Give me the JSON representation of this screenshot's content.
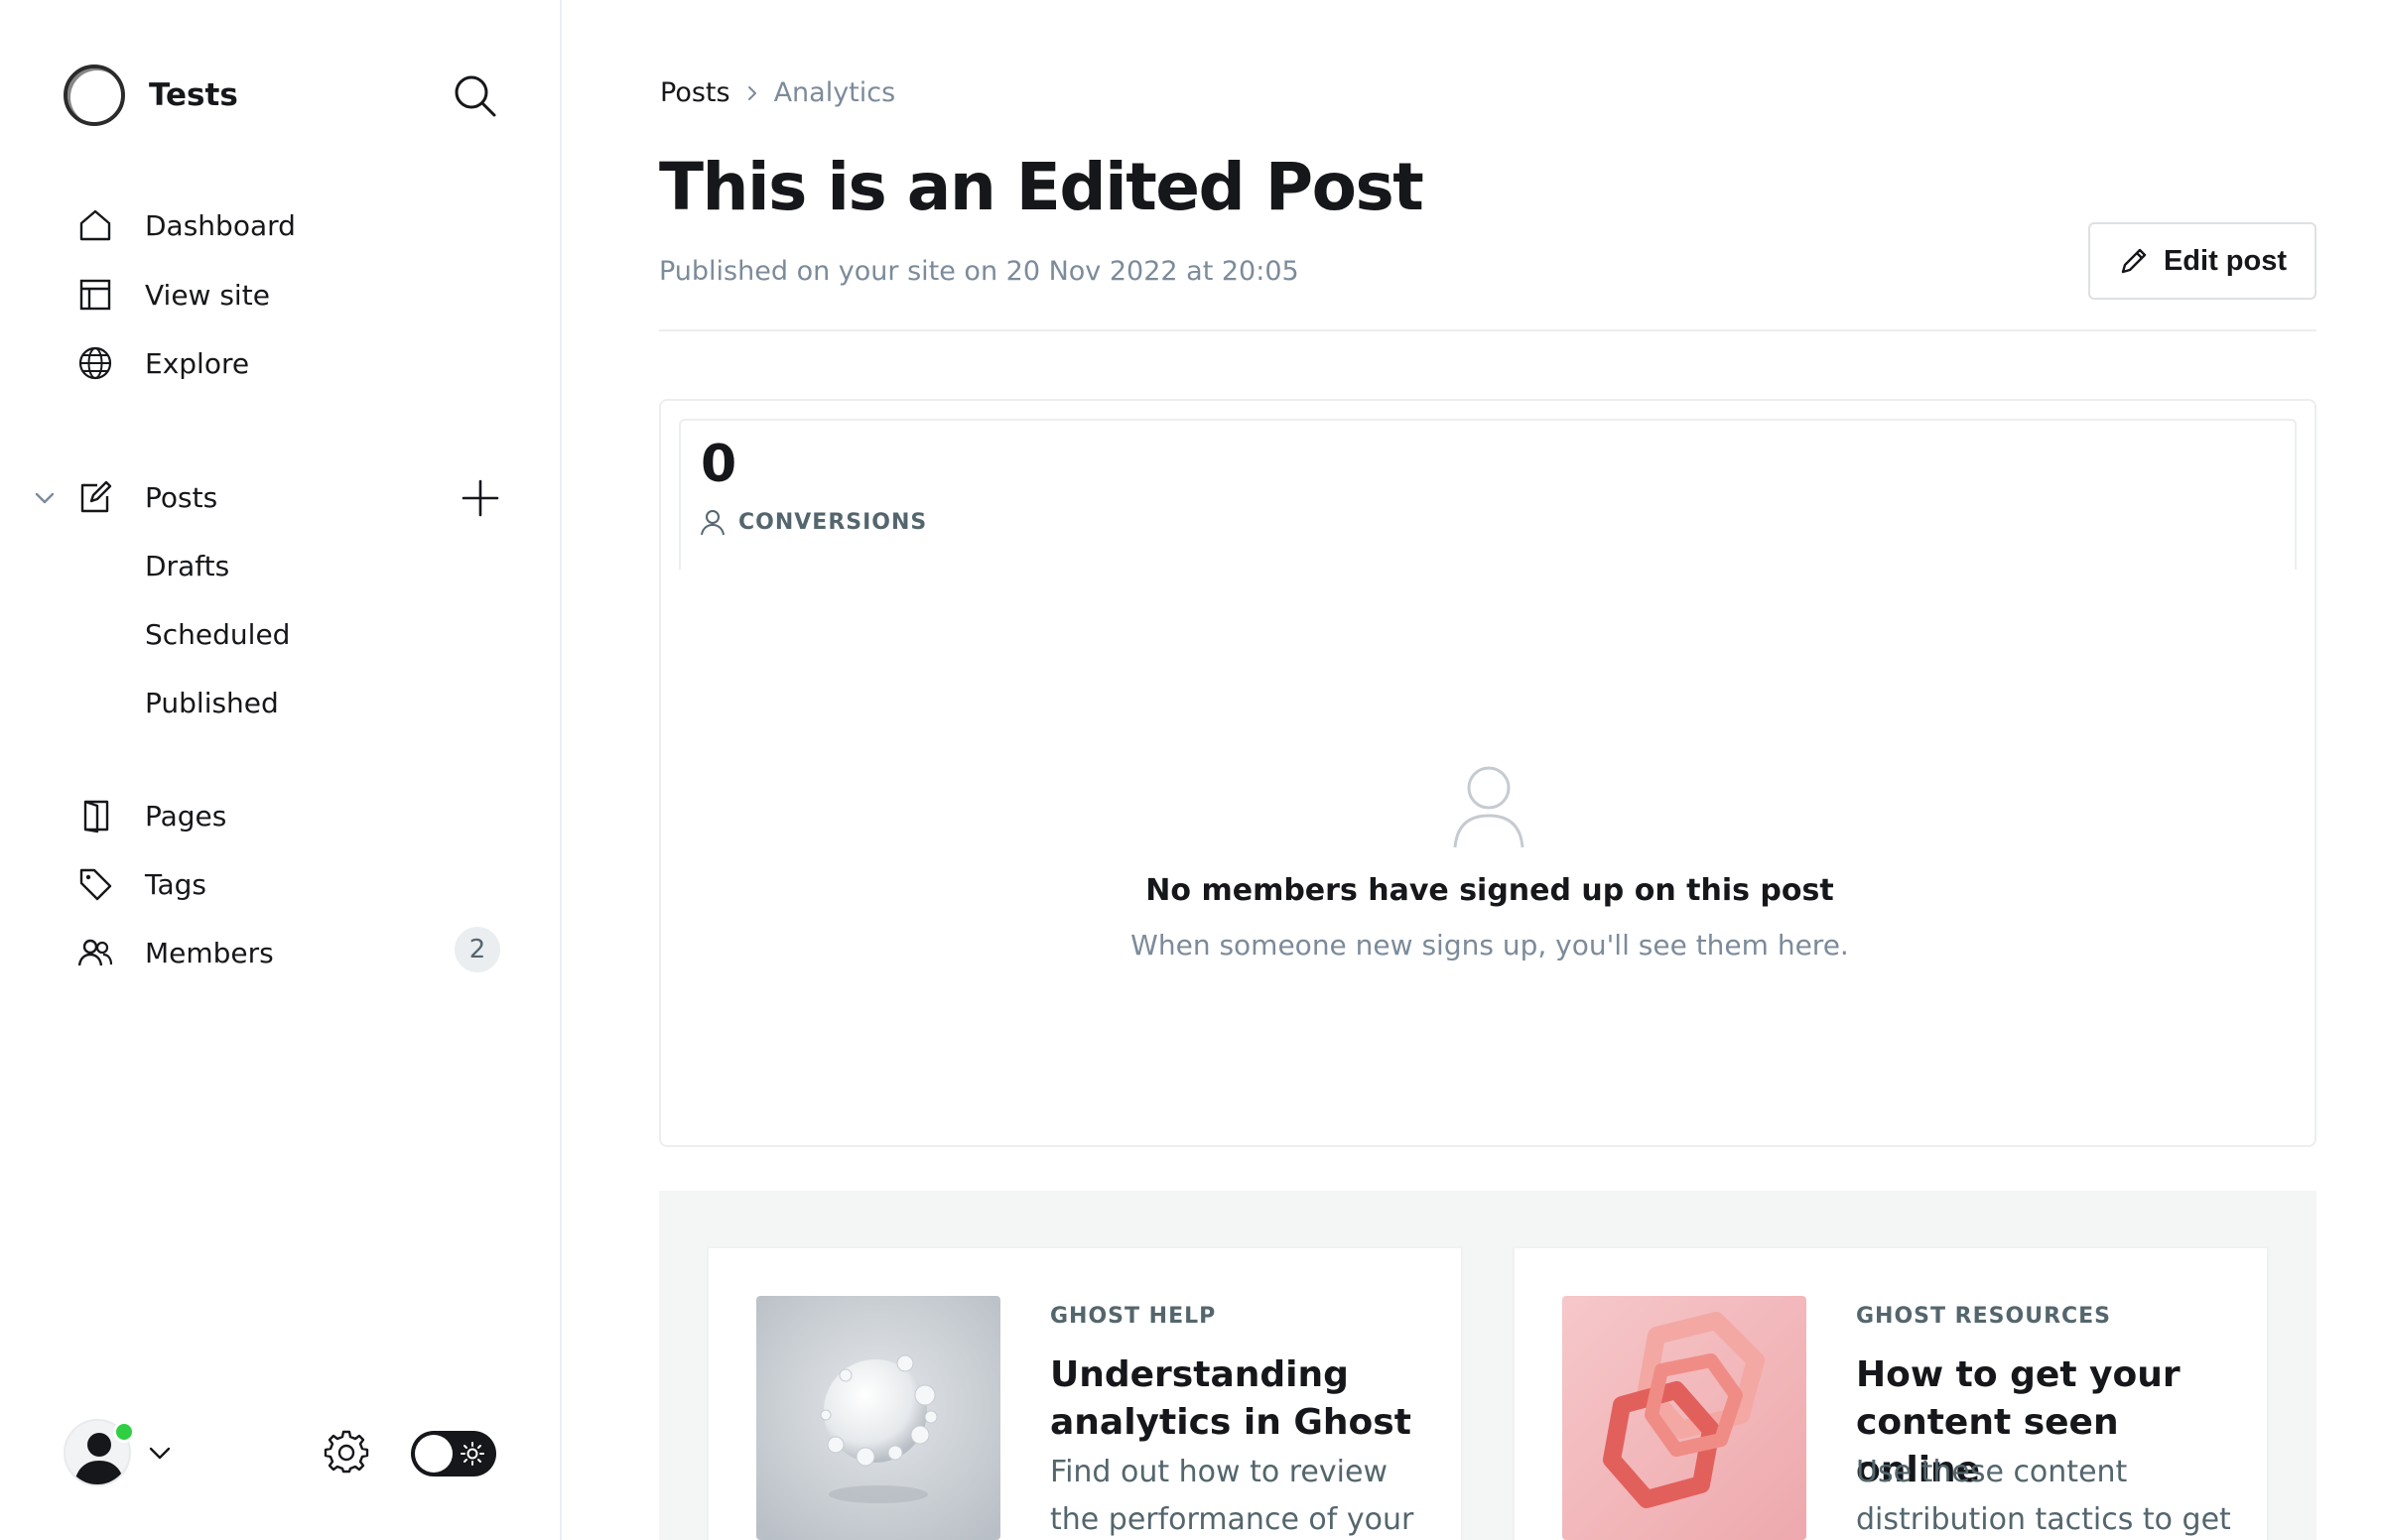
{
  "sidebar": {
    "site_name": "Tests",
    "nav": [
      {
        "label": "Dashboard",
        "icon": "home-icon"
      },
      {
        "label": "View site",
        "icon": "layout-icon"
      },
      {
        "label": "Explore",
        "icon": "globe-icon"
      }
    ],
    "posts": {
      "label": "Posts",
      "icon": "edit-icon",
      "children": [
        "Drafts",
        "Scheduled",
        "Published"
      ]
    },
    "more": [
      {
        "label": "Pages",
        "icon": "page-icon"
      },
      {
        "label": "Tags",
        "icon": "tag-icon"
      },
      {
        "label": "Members",
        "icon": "members-icon",
        "count": "2"
      }
    ]
  },
  "breadcrumb": {
    "root": "Posts",
    "current": "Analytics"
  },
  "post": {
    "title": "This is an Edited Post",
    "published": "Published on your site on 20 Nov 2022 at 20:05",
    "edit_label": "Edit post"
  },
  "conversions": {
    "value": "0",
    "label": "CONVERSIONS",
    "empty_title": "No members have signed up on this post",
    "empty_sub": "When someone new signs up, you'll see them here."
  },
  "resources": [
    {
      "category": "GHOST HELP",
      "title": "Understanding analytics in Ghost",
      "desc": "Find out how to review the performance of your"
    },
    {
      "category": "GHOST RESOURCES",
      "title": "How to get your content seen online",
      "desc": "Use these content distribution tactics to get"
    }
  ],
  "colors": {
    "accent_online": "#30cf43",
    "muted_text": "#7c8b9a",
    "border": "#ebeef0"
  }
}
